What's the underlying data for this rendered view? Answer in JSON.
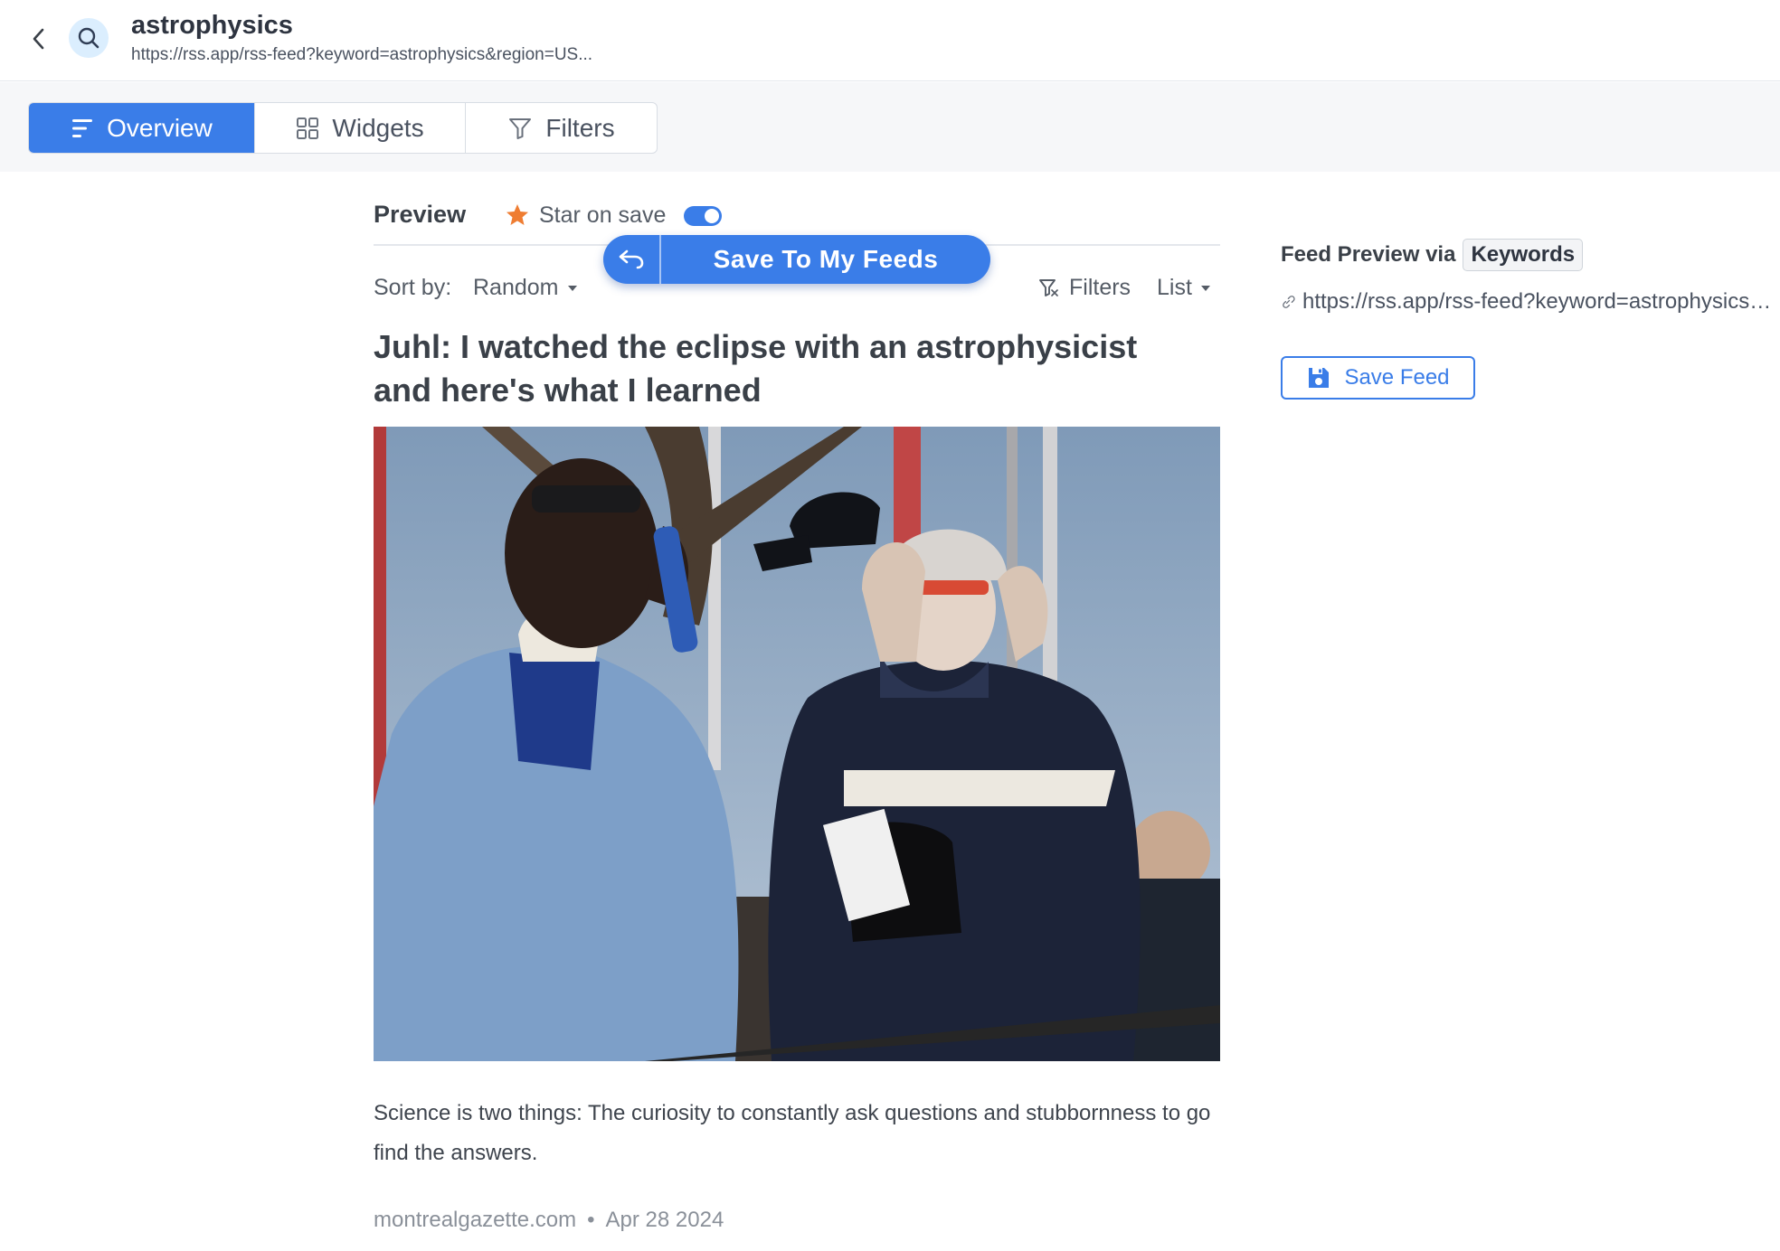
{
  "header": {
    "title": "astrophysics",
    "url": "https://rss.app/rss-feed?keyword=astrophysics&region=US..."
  },
  "tabs": [
    {
      "label": "Overview",
      "active": true
    },
    {
      "label": "Widgets",
      "active": false
    },
    {
      "label": "Filters",
      "active": false
    }
  ],
  "preview": {
    "title": "Preview",
    "star_label": "Star on save",
    "star_on_save": true,
    "save_button_label": "Save To My Feeds",
    "sort_label": "Sort by:",
    "sort_value": "Random",
    "filters_label": "Filters",
    "view_label": "List"
  },
  "article": {
    "title": "Juhl: I watched the eclipse with an astrophysicist and here's what I learned",
    "description": "Science is two things: The curiosity to constantly ask questions and stubbornness to go find the answers.",
    "source": "montrealgazette.com",
    "separator": "•",
    "date": "Apr 28 2024"
  },
  "side_panel": {
    "label": "Feed Preview via",
    "badge": "Keywords",
    "link": "https://rss.app/rss-feed?keyword=astrophysics&region=US&lang=en",
    "save_feed_label": "Save Feed"
  },
  "colors": {
    "accent": "#3a7de8",
    "star": "#ef7d32",
    "text": "#333a44"
  },
  "icons": {
    "back": "chevron-left-icon",
    "search": "search-icon",
    "overview": "list-lines-icon",
    "widgets": "grid-icon",
    "filters": "funnel-icon",
    "star": "star-icon",
    "undo": "undo-arrow-icon",
    "link": "link-icon",
    "save": "floppy-disk-icon"
  }
}
